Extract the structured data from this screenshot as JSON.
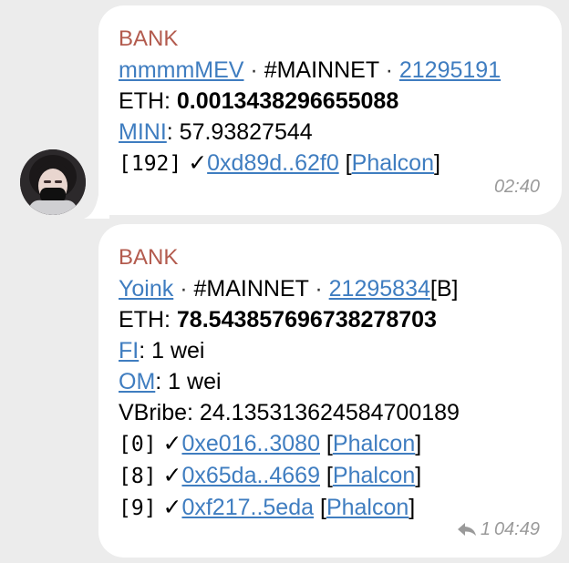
{
  "messages": [
    {
      "sender": "BANK",
      "header": {
        "name": "mmmmMEV",
        "network": "#MAINNET",
        "block": "21295191",
        "suffix": ""
      },
      "eth_label": "ETH: ",
      "eth_value": "0.0013438296655088",
      "tokens": [
        {
          "name": "MINI",
          "value": ": 57.93827544"
        }
      ],
      "vbribe": "",
      "txs": [
        {
          "index": "[192]",
          "check": " ✓",
          "hash": "0xd89d..62f0",
          "open": " [",
          "tool": "Phalcon",
          "close": "]"
        }
      ],
      "time": "02:40"
    },
    {
      "sender": "BANK",
      "header": {
        "name": "Yoink",
        "network": "#MAINNET",
        "block": "21295834",
        "suffix": "[B]"
      },
      "eth_label": "ETH: ",
      "eth_value": "78.543857696738278703",
      "tokens": [
        {
          "name": "FI",
          "value": ": 1 wei"
        },
        {
          "name": "OM",
          "value": ": 1 wei"
        }
      ],
      "vbribe": "VBribe: 24.135313624584700189",
      "txs": [
        {
          "index": "[0]",
          "check": " ✓",
          "hash": "0xe016..3080",
          "open": " [",
          "tool": "Phalcon",
          "close": "]"
        },
        {
          "index": "[8]",
          "check": " ✓",
          "hash": "0x65da..4669",
          "open": " [",
          "tool": "Phalcon",
          "close": "]"
        },
        {
          "index": "[9]",
          "check": " ✓",
          "hash": "0xf217..5eda",
          "open": " [",
          "tool": "Phalcon",
          "close": "]"
        }
      ],
      "reply_count": "1",
      "time": "04:49"
    }
  ],
  "separator": " · ",
  "colors": {
    "sender": "#b35b4e",
    "link": "#3f7dc0",
    "time": "#9a9a9a"
  },
  "icons": {
    "avatar": "avatar-image",
    "reply": "reply-icon"
  }
}
